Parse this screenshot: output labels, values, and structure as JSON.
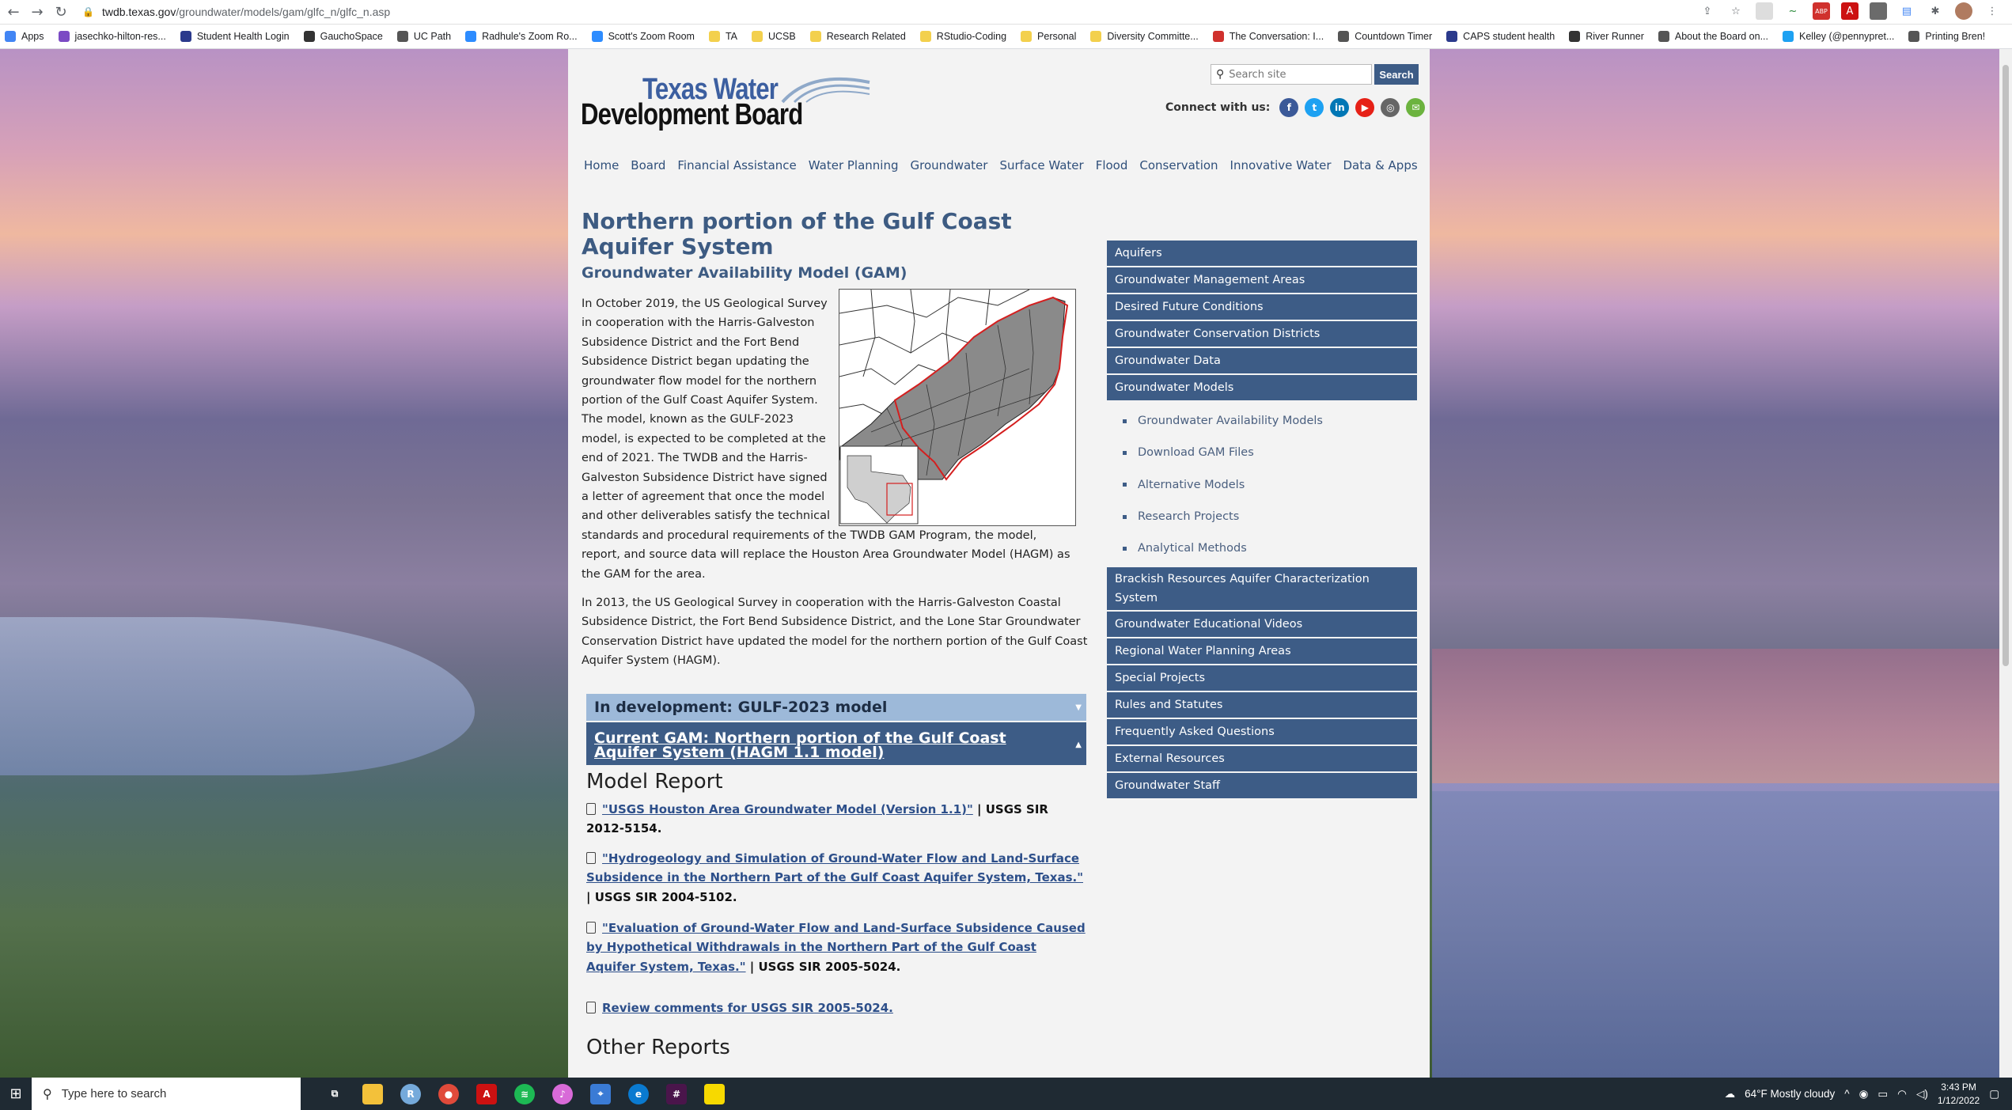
{
  "browser": {
    "url_host": "twdb.texas.gov",
    "url_path": "/groundwater/models/gam/glfc_n/glfc_n.asp",
    "bookmarks": [
      {
        "label": "Apps",
        "color": "#4285f4"
      },
      {
        "label": "jasechko-hilton-res...",
        "color": "#7b4bc4"
      },
      {
        "label": "Student Health Login",
        "color": "#2b3a8c"
      },
      {
        "label": "GauchoSpace",
        "color": "#333333"
      },
      {
        "label": "UC Path",
        "color": "#555555"
      },
      {
        "label": "Radhule's Zoom Ro...",
        "color": "#2d8cff"
      },
      {
        "label": "Scott's Zoom Room",
        "color": "#2d8cff"
      },
      {
        "label": "TA",
        "color": "folder"
      },
      {
        "label": "UCSB",
        "color": "folder"
      },
      {
        "label": "Research Related",
        "color": "folder"
      },
      {
        "label": "RStudio-Coding",
        "color": "folder"
      },
      {
        "label": "Personal",
        "color": "folder"
      },
      {
        "label": "Diversity Committe...",
        "color": "folder"
      },
      {
        "label": "The Conversation: I...",
        "color": "#d0312d"
      },
      {
        "label": "Countdown Timer",
        "color": "#555555"
      },
      {
        "label": "CAPS student health",
        "color": "#2b3a8c"
      },
      {
        "label": "River Runner",
        "color": "#333333"
      },
      {
        "label": "About the Board on...",
        "color": "#555555"
      },
      {
        "label": "Kelley (@pennypret...",
        "color": "#1da1f2"
      },
      {
        "label": "Printing Bren!",
        "color": "#555555"
      }
    ]
  },
  "site": {
    "logo_line1": "Texas Water",
    "logo_line2": "Development Board",
    "search_placeholder": "Search site",
    "search_button": "Search",
    "connect_label": "Connect with us:",
    "social_icons": [
      {
        "name": "facebook-icon",
        "glyph": "f",
        "color": "#3b5998"
      },
      {
        "name": "twitter-icon",
        "glyph": "t",
        "color": "#1da1f2"
      },
      {
        "name": "linkedin-icon",
        "glyph": "in",
        "color": "#0077b5"
      },
      {
        "name": "youtube-icon",
        "glyph": "▶",
        "color": "#e62117"
      },
      {
        "name": "instagram-icon",
        "glyph": "◎",
        "color": "#666666"
      },
      {
        "name": "email-icon",
        "glyph": "✉",
        "color": "#6cb33f"
      }
    ],
    "nav": [
      "Home",
      "Board",
      "Financial Assistance",
      "Water Planning",
      "Groundwater",
      "Surface Water",
      "Flood",
      "Conservation",
      "Innovative Water",
      "Data & Apps"
    ]
  },
  "main": {
    "title": "Northern portion of the Gulf Coast Aquifer System",
    "subtitle": "Groundwater Availability Model (GAM)",
    "para1": "In October 2019, the US Geological Survey in cooperation with the Harris-Galveston Subsidence District and the Fort Bend Subsidence District began updating the groundwater flow model for the northern portion of the Gulf Coast Aquifer System. The model, known as the GULF-2023 model, is expected to be completed at the end of 2021. The TWDB and the Harris-Galveston Subsidence District have signed a letter of agreement that once the model and other deliverables satisfy the technical standards and procedural requirements of the TWDB GAM Program, the model, report, and source data will replace the Houston Area Groundwater Model (HAGM) as the GAM for the area.",
    "para2": "In 2013, the US Geological Survey in cooperation with the Harris-Galveston Coastal Subsidence District, the Fort Bend Subsidence District, and the Lone Star Groundwater Conservation District have updated the model for the northern portion of the Gulf Coast Aquifer System (HAGM).",
    "accordion1": "In development: GULF-2023 model",
    "accordion2": "Current GAM: Northern portion of the Gulf Coast Aquifer System (HAGM 1.1 model)",
    "model_report_heading": "Model Report",
    "documents": [
      {
        "link": "\"USGS Houston Area Groundwater Model (Version 1.1)\"",
        "tail": " | USGS SIR 2012-5154."
      },
      {
        "link": "\"Hydrogeology and Simulation of Ground-Water Flow and Land-Surface Subsidence in the Northern Part of the Gulf Coast Aquifer System, Texas.\"",
        "tail": " | USGS SIR 2004-5102."
      },
      {
        "link": "\"Evaluation of Ground-Water Flow and Land-Surface Subsidence Caused by Hypothetical Withdrawals in the Northern Part of the Gulf Coast Aquifer System, Texas.\"",
        "tail": " | USGS SIR 2005-5024."
      },
      {
        "link": "Review comments for USGS SIR 2005-5024.",
        "tail": ""
      }
    ],
    "other_reports_heading": "Other Reports"
  },
  "sidebar": {
    "items_top": [
      "Aquifers",
      "Groundwater Management Areas",
      "Desired Future Conditions",
      "Groundwater Conservation Districts",
      "Groundwater Data",
      "Groundwater Models"
    ],
    "sub_items": [
      "Groundwater Availability Models",
      "Download GAM Files",
      "Alternative Models",
      "Research Projects",
      "Analytical Methods"
    ],
    "items_bottom": [
      "Brackish Resources Aquifer Characterization System",
      "Groundwater Educational Videos",
      "Regional Water Planning Areas",
      "Special Projects",
      "Rules and Statutes",
      "Frequently Asked Questions",
      "External Resources",
      "Groundwater Staff"
    ]
  },
  "taskbar": {
    "search_placeholder": "Type here to search",
    "weather": "64°F  Mostly cloudy",
    "time": "3:43 PM",
    "date": "1/12/2022"
  }
}
